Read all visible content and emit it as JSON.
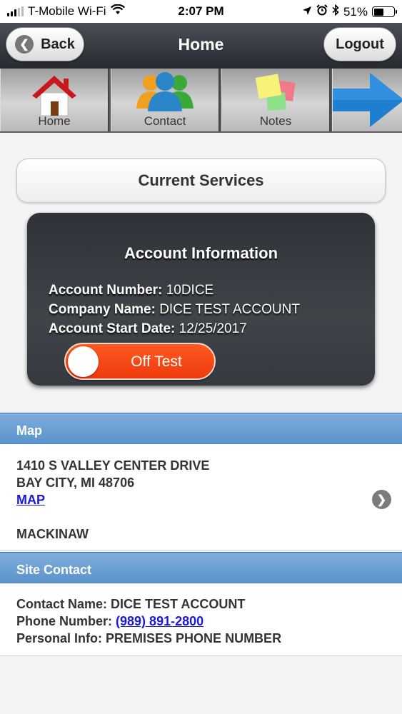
{
  "status_bar": {
    "carrier": "T-Mobile Wi-Fi",
    "time": "2:07 PM",
    "battery": "51%",
    "battery_level": 0.51,
    "icons": [
      "signal-icon",
      "wifi-icon",
      "location-icon",
      "alarm-icon",
      "bluetooth-icon",
      "battery-icon"
    ]
  },
  "header": {
    "title": "Home",
    "back_label": "Back",
    "logout_label": "Logout"
  },
  "nav": {
    "items": [
      {
        "label": "Home",
        "icon": "house-icon"
      },
      {
        "label": "Contact",
        "icon": "contacts-icon"
      },
      {
        "label": "Notes",
        "icon": "notes-icon"
      },
      {
        "label": "",
        "icon": "arrow-right-icon"
      }
    ]
  },
  "services": {
    "label": "Current Services"
  },
  "account": {
    "title": "Account Information",
    "number_label": "Account Number:",
    "number": "10DICE",
    "company_label": "Company Name:",
    "company": "DICE TEST ACCOUNT",
    "start_label": "Account Start Date:",
    "start": "12/25/2017",
    "toggle_label": "Off Test",
    "toggle_color": "#f2440f"
  },
  "map": {
    "header": "Map",
    "address1": "1410 S VALLEY CENTER DRIVE",
    "address2": "BAY CITY, MI 48706",
    "link": "MAP",
    "area": "MACKINAW"
  },
  "site_contact": {
    "header": "Site Contact",
    "name_label": "Contact Name:",
    "name": "DICE TEST ACCOUNT",
    "phone_label": "Phone Number:",
    "phone": "(989) 891-2800",
    "info_label": "Personal Info:",
    "info": "PREMISES PHONE NUMBER"
  },
  "colors": {
    "section_header": "#6a9fd4",
    "link": "#1a1ad6",
    "header_bg": "#353a40"
  }
}
